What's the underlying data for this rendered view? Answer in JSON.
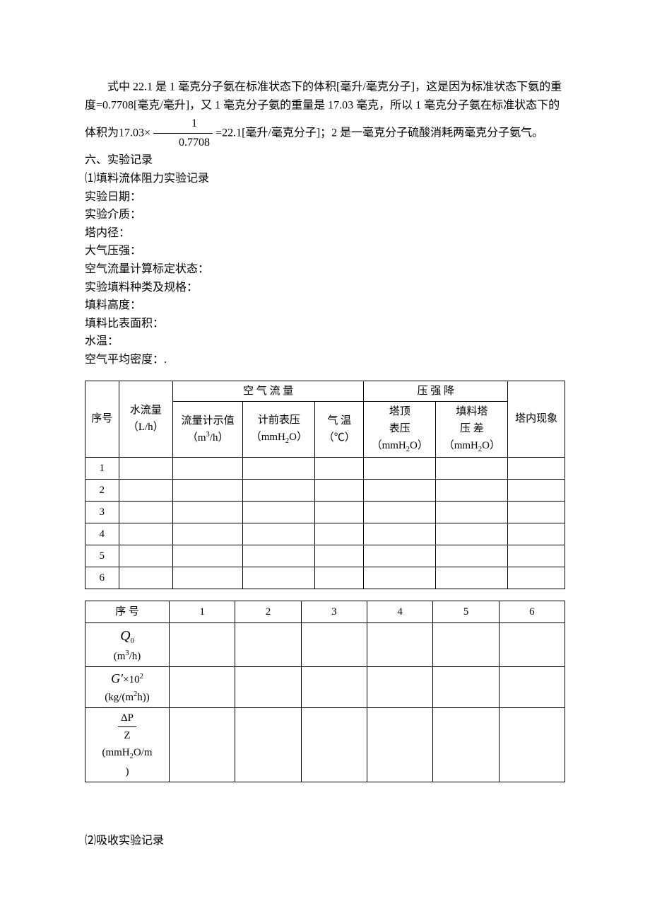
{
  "para1": {
    "t1": "式中 22.1 是 1 毫克分子氨在标准状态下的体积[毫升/毫克分子]，这是因为标准状态下氨的重度=0.7708[毫克/毫升]，又 1 毫克分子氨的重量是 17.03 毫克，所以 1 毫克分子氨在标准状态下的体积为",
    "eq_lhs": "17.03×",
    "eq_num": "1",
    "eq_den": "0.7708",
    "eq_rhs": "=22.1",
    "t2": "[毫升/毫克分子]；2 是一毫克分子硫酸消耗两毫克分子氨气。"
  },
  "section6": "六、实验记录",
  "rec1_title": "⑴填料流体阻力实验记录",
  "fields": [
    "实验日期：",
    "实验介质：",
    "塔内径：",
    "大气压强：",
    "空气流量计算标定状态：",
    "实验填料种类及规格：",
    "填料高度：",
    "填料比表面积：",
    "水温：",
    "空气平均密度：."
  ],
  "table1": {
    "h_seq": "序号",
    "h_water": "水流量（L/h）",
    "h_airflow": "空 气 流 量",
    "h_pressure": "压 强 降",
    "h_phenom": "塔内现象",
    "h_meter_val_l1": "流量计示值",
    "h_meter_val_l2": "（m",
    "h_meter_val_sup": "3",
    "h_meter_val_l3": "/h）",
    "h_pre_gauge_l1": "计前表压",
    "h_pre_gauge_l2": "（mmH",
    "h_pre_gauge_sub": "2",
    "h_pre_gauge_l3": "O）",
    "h_temp_l1": "气 温",
    "h_temp_l2": "（℃）",
    "h_top_l1": "塔顶",
    "h_top_l2": "表压",
    "h_top_l3a": "（mmH",
    "h_top_sub": "2",
    "h_top_l3b": "O）",
    "h_pack_l1": "填料塔",
    "h_pack_l2": "压 差",
    "h_pack_l3a": "（mmH",
    "h_pack_sub": "2",
    "h_pack_l3b": "O）",
    "rows": [
      "1",
      "2",
      "3",
      "4",
      "5",
      "6"
    ]
  },
  "table2": {
    "h_seq": "序 号",
    "cols": [
      "1",
      "2",
      "3",
      "4",
      "5",
      "6"
    ],
    "r1_sym": "Q",
    "r1_sub": "0",
    "r1_unit_a": "(m",
    "r1_unit_sup": "3",
    "r1_unit_b": "/h)",
    "r2_sym": "G′",
    "r2_mul": "×10",
    "r2_sup": "2",
    "r2_unit_a": "(kg/(m",
    "r2_unit_sup": "2",
    "r2_unit_b": "h))",
    "r3_num": "ΔP",
    "r3_den": "Z",
    "r3_unit_a": "(mmH",
    "r3_unit_sub": "2",
    "r3_unit_b": "O/m",
    "r3_unit_c": ")"
  },
  "rec2_title": "⑵吸收实验记录"
}
